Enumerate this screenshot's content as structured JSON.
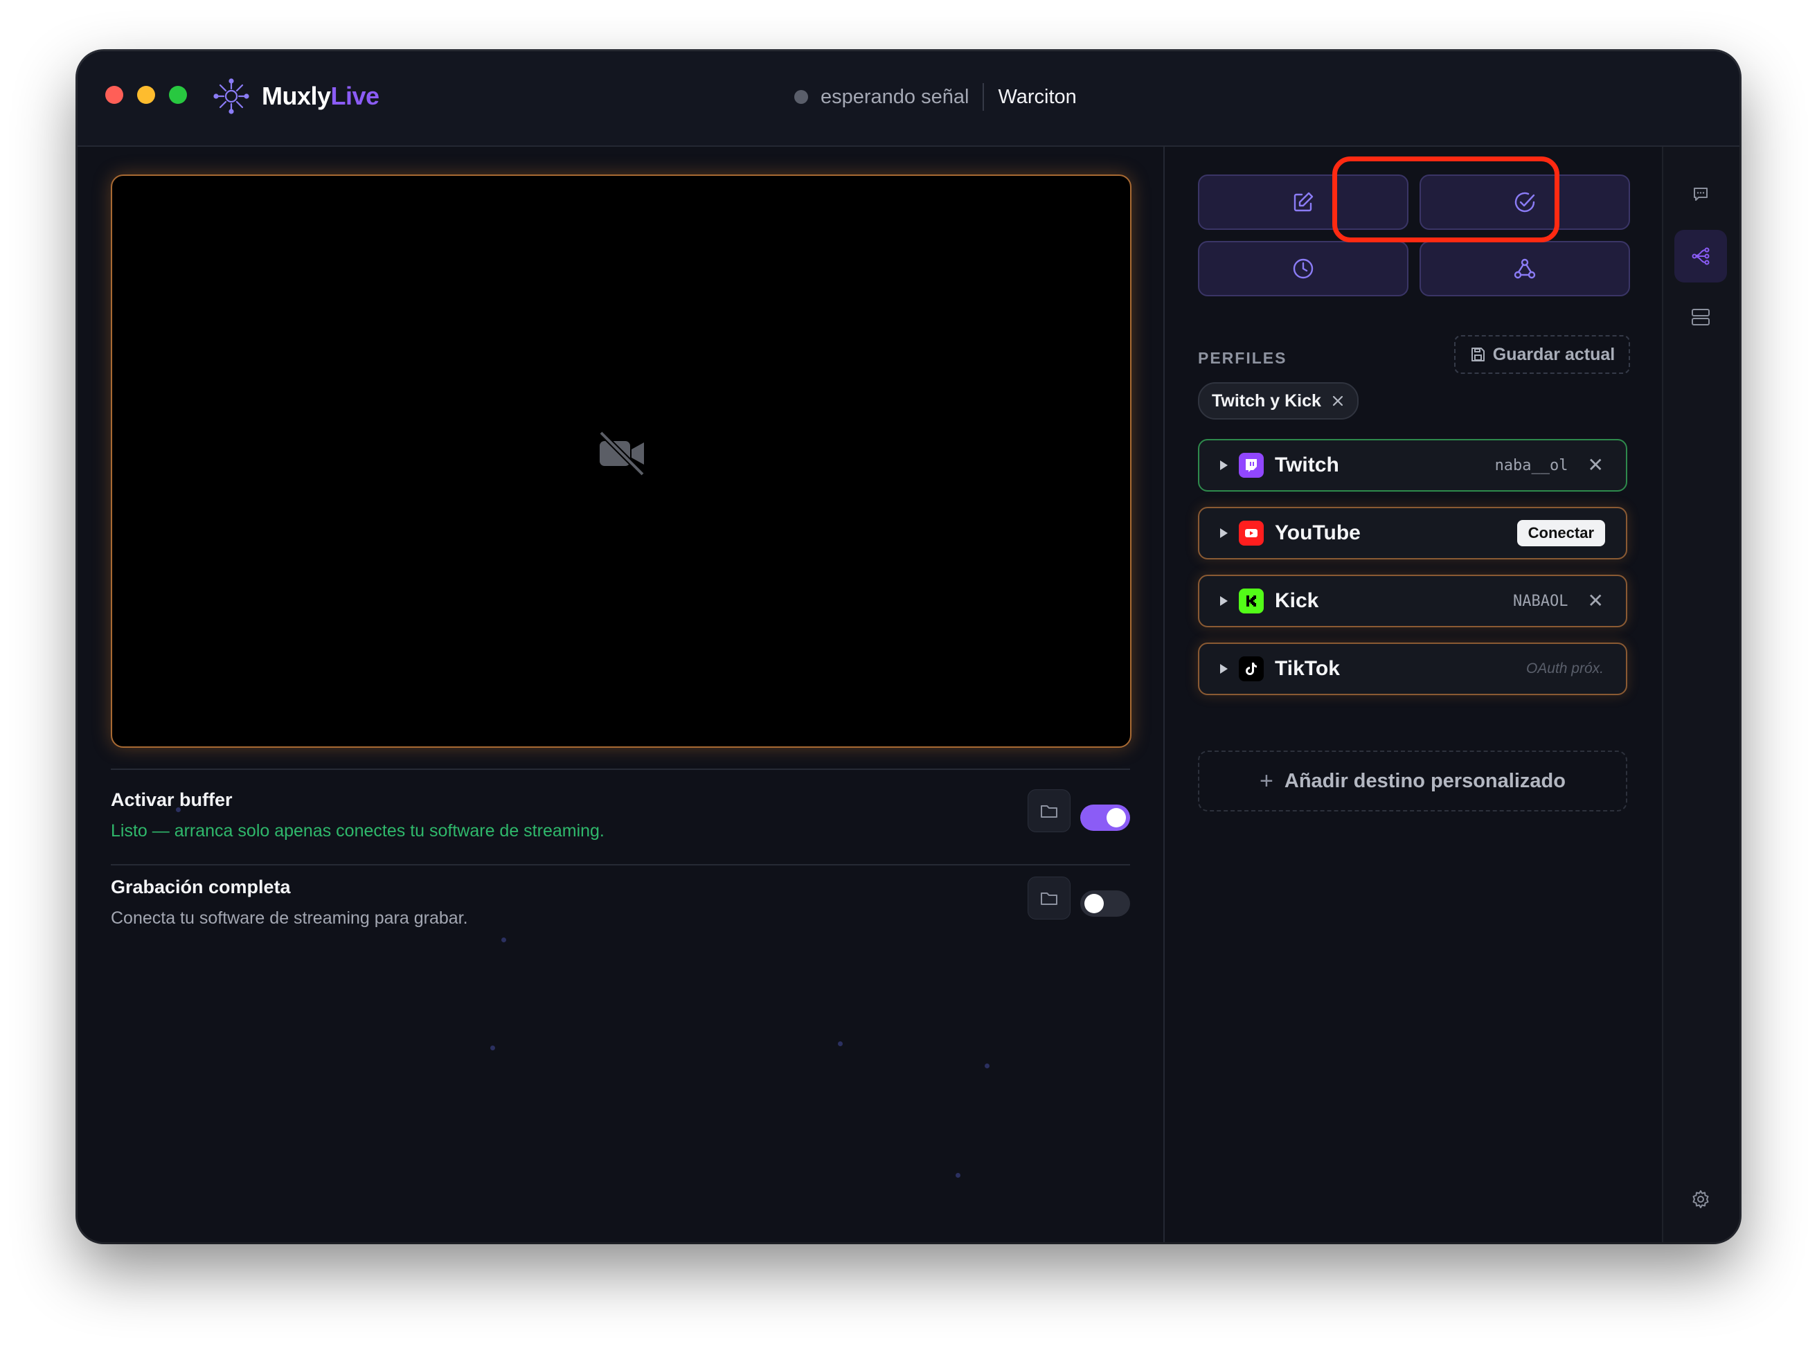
{
  "app": {
    "brand_prefix": "Muxly",
    "brand_suffix": "Live",
    "status_text": "esperando señal",
    "channel": "Warciton"
  },
  "colors": {
    "accent": "#8b5cf6",
    "window_bg": "#0f1119",
    "success": "#2fb86b",
    "warning_border": "#a86a33",
    "highlight": "#ff2a12"
  },
  "toolbar": {
    "buttons": [
      {
        "icon": "edit-icon"
      },
      {
        "icon": "check-circle-icon",
        "highlighted": true
      },
      {
        "icon": "clock-icon"
      },
      {
        "icon": "webhook-icon"
      }
    ]
  },
  "recording": {
    "buffer": {
      "title": "Activar buffer",
      "subtitle": "Listo — arranca solo apenas conectes tu software de streaming.",
      "enabled": true
    },
    "full": {
      "title": "Grabación completa",
      "subtitle": "Conecta tu software de streaming para grabar.",
      "enabled": false
    }
  },
  "profiles": {
    "label": "PERFILES",
    "save_label": "Guardar actual",
    "active_profile": "Twitch y Kick"
  },
  "destinations": [
    {
      "name": "Twitch",
      "account": "naba__ol",
      "state": "connected",
      "icon": "twitch-icon"
    },
    {
      "name": "YouTube",
      "action": "Conectar",
      "state": "disconnected",
      "icon": "youtube-icon"
    },
    {
      "name": "Kick",
      "account": "NABAOL",
      "state": "connected",
      "icon": "kick-icon"
    },
    {
      "name": "TikTok",
      "note": "OAuth próx.",
      "state": "unavailable",
      "icon": "tiktok-icon"
    }
  ],
  "add_destination": "Añadir destino personalizado",
  "rail": [
    "chat-icon",
    "routing-icon",
    "server-icon",
    "settings-icon"
  ]
}
